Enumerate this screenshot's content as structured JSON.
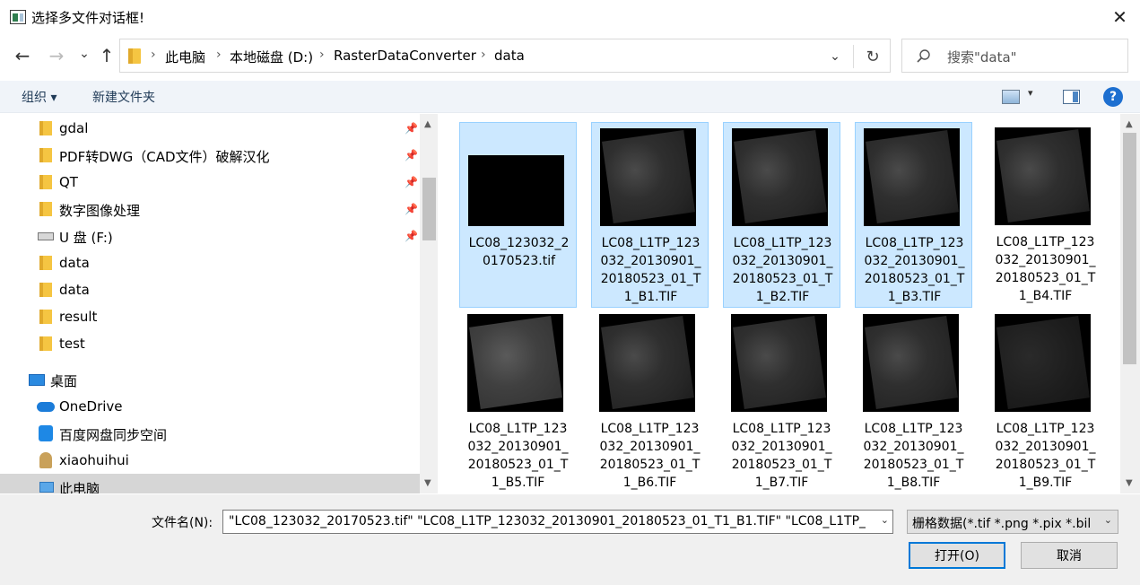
{
  "window": {
    "title": "选择多文件对话框!",
    "close": "✕"
  },
  "nav_buttons": {
    "back": "←",
    "forward": "→",
    "recent": "⌄",
    "up": "↑"
  },
  "address": {
    "crumbs": [
      "此电脑",
      "本地磁盘 (D:)",
      "RasterDataConverter",
      "data"
    ],
    "separator": "›",
    "dropdown": "⌄",
    "refresh": "↻"
  },
  "search": {
    "placeholder": "搜索\"data\""
  },
  "toolbar": {
    "organize": "组织 ▾",
    "new_folder": "新建文件夹",
    "view_dd": "▾",
    "help": "?"
  },
  "sidebar": {
    "items": [
      {
        "label": "gdal",
        "icon": "folder-icon",
        "pinned": true
      },
      {
        "label": "PDF转DWG（CAD文件）破解汉化",
        "icon": "folder-icon",
        "pinned": true
      },
      {
        "label": "QT",
        "icon": "folder-icon",
        "pinned": true
      },
      {
        "label": "数字图像处理",
        "icon": "folder-icon",
        "pinned": true
      },
      {
        "label": "U 盘 (F:)",
        "icon": "usb-drive-icon",
        "pinned": true
      },
      {
        "label": "data",
        "icon": "folder-icon"
      },
      {
        "label": "data",
        "icon": "folder-icon"
      },
      {
        "label": "result",
        "icon": "folder-icon"
      },
      {
        "label": "test",
        "icon": "folder-icon"
      },
      {
        "label": "桌面",
        "icon": "desktop-icon"
      },
      {
        "label": "OneDrive",
        "icon": "onedrive-icon"
      },
      {
        "label": "百度网盘同步空间",
        "icon": "baidu-netdisk-icon"
      },
      {
        "label": "xiaohuihui",
        "icon": "user-icon"
      },
      {
        "label": "此电脑",
        "icon": "this-pc-icon",
        "selected": true
      }
    ],
    "pin_glyph": "📌"
  },
  "files": [
    {
      "name": "LC08_123032_20170523.tif",
      "selected": true,
      "thumb": "black"
    },
    {
      "name": "LC08_L1TP_123032_20130901_20180523_01_T1_B1.TIF",
      "selected": true,
      "thumb": "normal"
    },
    {
      "name": "LC08_L1TP_123032_20130901_20180523_01_T1_B2.TIF",
      "selected": true,
      "thumb": "normal"
    },
    {
      "name": "LC08_L1TP_123032_20130901_20180523_01_T1_B3.TIF",
      "selected": true,
      "thumb": "normal"
    },
    {
      "name": "LC08_L1TP_123032_20130901_20180523_01_T1_B4.TIF",
      "selected": false,
      "thumb": "normal"
    },
    {
      "name": "LC08_L1TP_123032_20130901_20180523_01_T1_B5.TIF",
      "selected": false,
      "thumb": "light"
    },
    {
      "name": "LC08_L1TP_123032_20130901_20180523_01_T1_B6.TIF",
      "selected": false,
      "thumb": "normal"
    },
    {
      "name": "LC08_L1TP_123032_20130901_20180523_01_T1_B7.TIF",
      "selected": false,
      "thumb": "normal"
    },
    {
      "name": "LC08_L1TP_123032_20130901_20180523_01_T1_B8.TIF",
      "selected": false,
      "thumb": "normal"
    },
    {
      "name": "LC08_L1TP_123032_20130901_20180523_01_T1_B9.TIF",
      "selected": false,
      "thumb": "dark"
    }
  ],
  "file_names_display": [
    "LC08_123032_2\n0170523.tif",
    "LC08_L1TP_123\n032_20130901_\n20180523_01_T\n1_B1.TIF",
    "LC08_L1TP_123\n032_20130901_\n20180523_01_T\n1_B2.TIF",
    "LC08_L1TP_123\n032_20130901_\n20180523_01_T\n1_B3.TIF",
    "LC08_L1TP_123\n032_20130901_\n20180523_01_T\n1_B4.TIF",
    "LC08_L1TP_123\n032_20130901_\n20180523_01_T\n1_B5.TIF",
    "LC08_L1TP_123\n032_20130901_\n20180523_01_T\n1_B6.TIF",
    "LC08_L1TP_123\n032_20130901_\n20180523_01_T\n1_B7.TIF",
    "LC08_L1TP_123\n032_20130901_\n20180523_01_T\n1_B8.TIF",
    "LC08_L1TP_123\n032_20130901_\n20180523_01_T\n1_B9.TIF"
  ],
  "scroll_arrows": {
    "up": "▲",
    "down": "▼"
  },
  "footer": {
    "filename_label": "文件名(N):",
    "filename_value": "\"LC08_123032_20170523.tif\" \"LC08_L1TP_123032_20130901_20180523_01_T1_B1.TIF\" \"LC08_L1TP_",
    "filetype_value": "栅格数据(*.tif *.png *.pix *.bil",
    "dropdown": "⌄",
    "open_label": "打开(O)",
    "cancel_label": "取消"
  },
  "colors": {
    "selection": "#cce8ff",
    "selection_border": "#99d1ff",
    "accent": "#0078d7"
  }
}
